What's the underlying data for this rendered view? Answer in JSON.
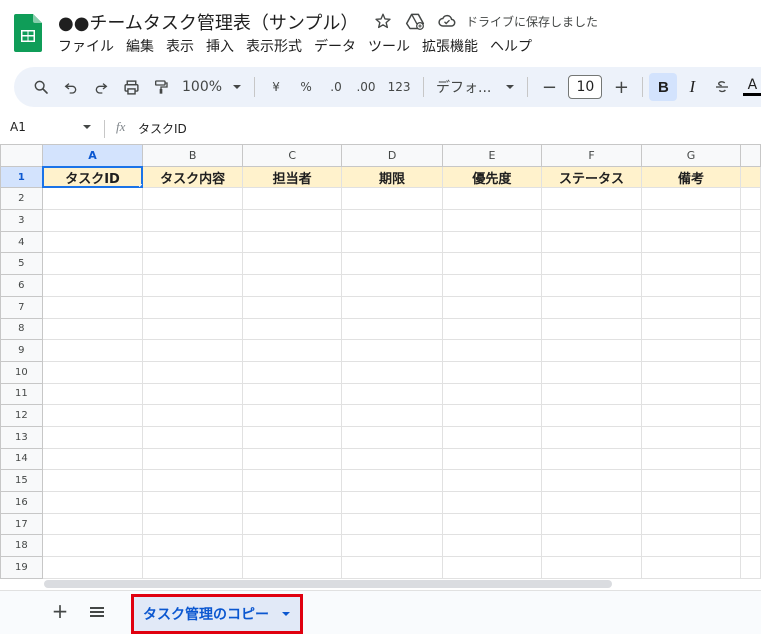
{
  "doc": {
    "title": "●●チームタスク管理表（サンプル）",
    "saved_status": "ドライブに保存しました"
  },
  "menu": [
    "ファイル",
    "編集",
    "表示",
    "挿入",
    "表示形式",
    "データ",
    "ツール",
    "拡張機能",
    "ヘルプ"
  ],
  "toolbar": {
    "zoom": "100%",
    "currency": "¥",
    "percent": "%",
    "dec_decrease": ".0",
    "dec_increase": ".00",
    "number_format": "123",
    "font": "デフォ...",
    "font_size": "10",
    "bold": "B",
    "italic": "I",
    "text_color": "A"
  },
  "formula_bar": {
    "cell_ref": "A1",
    "fx": "fx",
    "content": "タスクID"
  },
  "grid": {
    "columns": [
      "A",
      "B",
      "C",
      "D",
      "E",
      "F",
      "G"
    ],
    "header_row": [
      "タスクID",
      "タスク内容",
      "担当者",
      "期限",
      "優先度",
      "ステータス",
      "備考"
    ],
    "row_numbers": [
      "1",
      "2",
      "3",
      "4",
      "5",
      "6",
      "7",
      "8",
      "9",
      "10",
      "11",
      "12",
      "13",
      "14",
      "15",
      "16",
      "17",
      "18",
      "19"
    ]
  },
  "sheets": {
    "active_tab": "タスク管理のコピー"
  },
  "colors": {
    "header_fill": "#fff2cc",
    "selection": "#1a73e8",
    "tab_highlight": "#e0000f",
    "toolbar_bg": "#edf2fa"
  }
}
